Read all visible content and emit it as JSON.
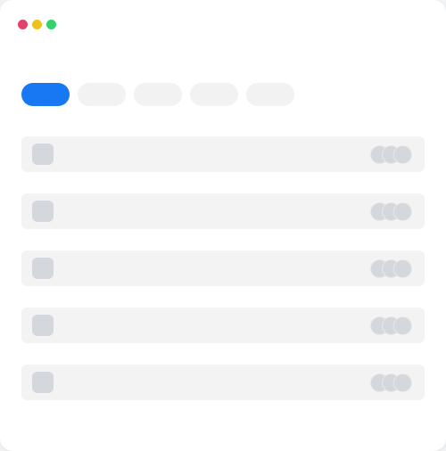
{
  "window": {
    "controls": [
      {
        "name": "close",
        "color": "#e5416b"
      },
      {
        "name": "minimize",
        "color": "#efc21a"
      },
      {
        "name": "maximize",
        "color": "#2ed36a"
      }
    ]
  },
  "tabs": [
    {
      "label": "",
      "active": true
    },
    {
      "label": "",
      "active": false
    },
    {
      "label": "",
      "active": false
    },
    {
      "label": "",
      "active": false
    },
    {
      "label": "",
      "active": false
    }
  ],
  "rows": [
    {
      "icon": "placeholder-icon",
      "avatars": 3
    },
    {
      "icon": "placeholder-icon",
      "avatars": 3
    },
    {
      "icon": "placeholder-icon",
      "avatars": 3
    },
    {
      "icon": "placeholder-icon",
      "avatars": 3
    },
    {
      "icon": "placeholder-icon",
      "avatars": 3
    }
  ],
  "colors": {
    "accent": "#1878f3",
    "placeholder": "#d4d7db",
    "surface": "#f3f3f4"
  }
}
